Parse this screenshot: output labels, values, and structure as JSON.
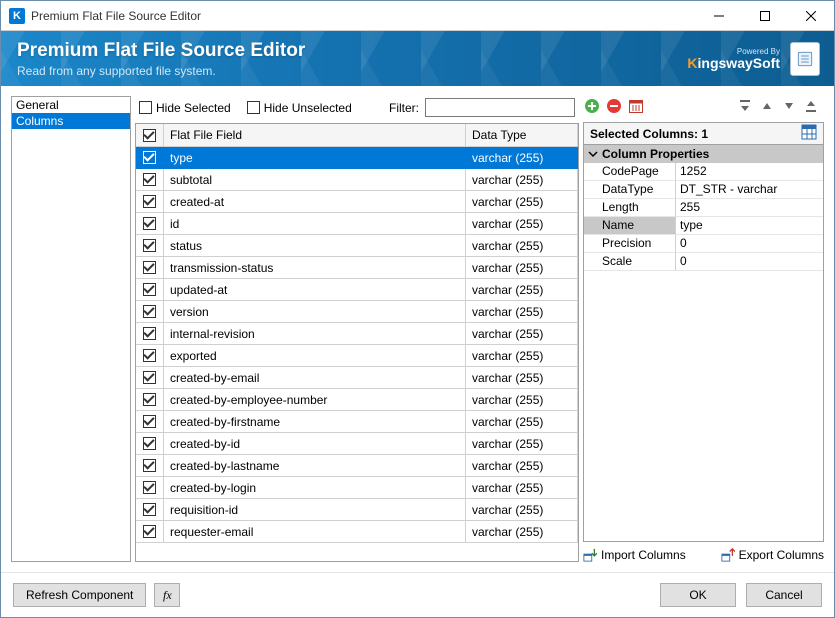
{
  "titlebar": {
    "title": "Premium Flat File Source Editor",
    "app_letter": "K"
  },
  "banner": {
    "title": "Premium Flat File Source Editor",
    "subtitle": "Read from any supported file system.",
    "powered": "Powered By",
    "brand_k": "K",
    "brand_rest": "ingswaySoft"
  },
  "nav": {
    "items": [
      {
        "label": "General",
        "selected": false
      },
      {
        "label": "Columns",
        "selected": true
      }
    ]
  },
  "toolbar": {
    "hide_selected": "Hide Selected",
    "hide_unselected": "Hide Unselected",
    "filter_label": "Filter:",
    "filter_value": ""
  },
  "grid": {
    "header": {
      "field": "Flat File Field",
      "datatype": "Data Type"
    },
    "rows": [
      {
        "name": "type",
        "dt": "varchar (255)",
        "selected": true
      },
      {
        "name": "subtotal",
        "dt": "varchar (255)"
      },
      {
        "name": "created-at",
        "dt": "varchar (255)"
      },
      {
        "name": "id",
        "dt": "varchar (255)"
      },
      {
        "name": "status",
        "dt": "varchar (255)"
      },
      {
        "name": "transmission-status",
        "dt": "varchar (255)"
      },
      {
        "name": "updated-at",
        "dt": "varchar (255)"
      },
      {
        "name": "version",
        "dt": "varchar (255)"
      },
      {
        "name": "internal-revision",
        "dt": "varchar (255)"
      },
      {
        "name": "exported",
        "dt": "varchar (255)"
      },
      {
        "name": "created-by-email",
        "dt": "varchar (255)"
      },
      {
        "name": "created-by-employee-number",
        "dt": "varchar (255)"
      },
      {
        "name": "created-by-firstname",
        "dt": "varchar (255)"
      },
      {
        "name": "created-by-id",
        "dt": "varchar (255)"
      },
      {
        "name": "created-by-lastname",
        "dt": "varchar (255)"
      },
      {
        "name": "created-by-login",
        "dt": "varchar (255)"
      },
      {
        "name": "requisition-id",
        "dt": "varchar (255)"
      },
      {
        "name": "requester-email",
        "dt": "varchar (255)"
      }
    ]
  },
  "rpanel": {
    "selected_label": "Selected Columns: 1",
    "section": "Column Properties",
    "props": [
      {
        "k": "CodePage",
        "v": "1252"
      },
      {
        "k": "DataType",
        "v": "DT_STR - varchar"
      },
      {
        "k": "Length",
        "v": "255"
      },
      {
        "k": "Name",
        "v": "type",
        "sel": true
      },
      {
        "k": "Precision",
        "v": "0"
      },
      {
        "k": "Scale",
        "v": "0"
      }
    ],
    "import": "Import Columns",
    "export": "Export Columns"
  },
  "footer": {
    "refresh": "Refresh Component",
    "ok": "OK",
    "cancel": "Cancel"
  }
}
